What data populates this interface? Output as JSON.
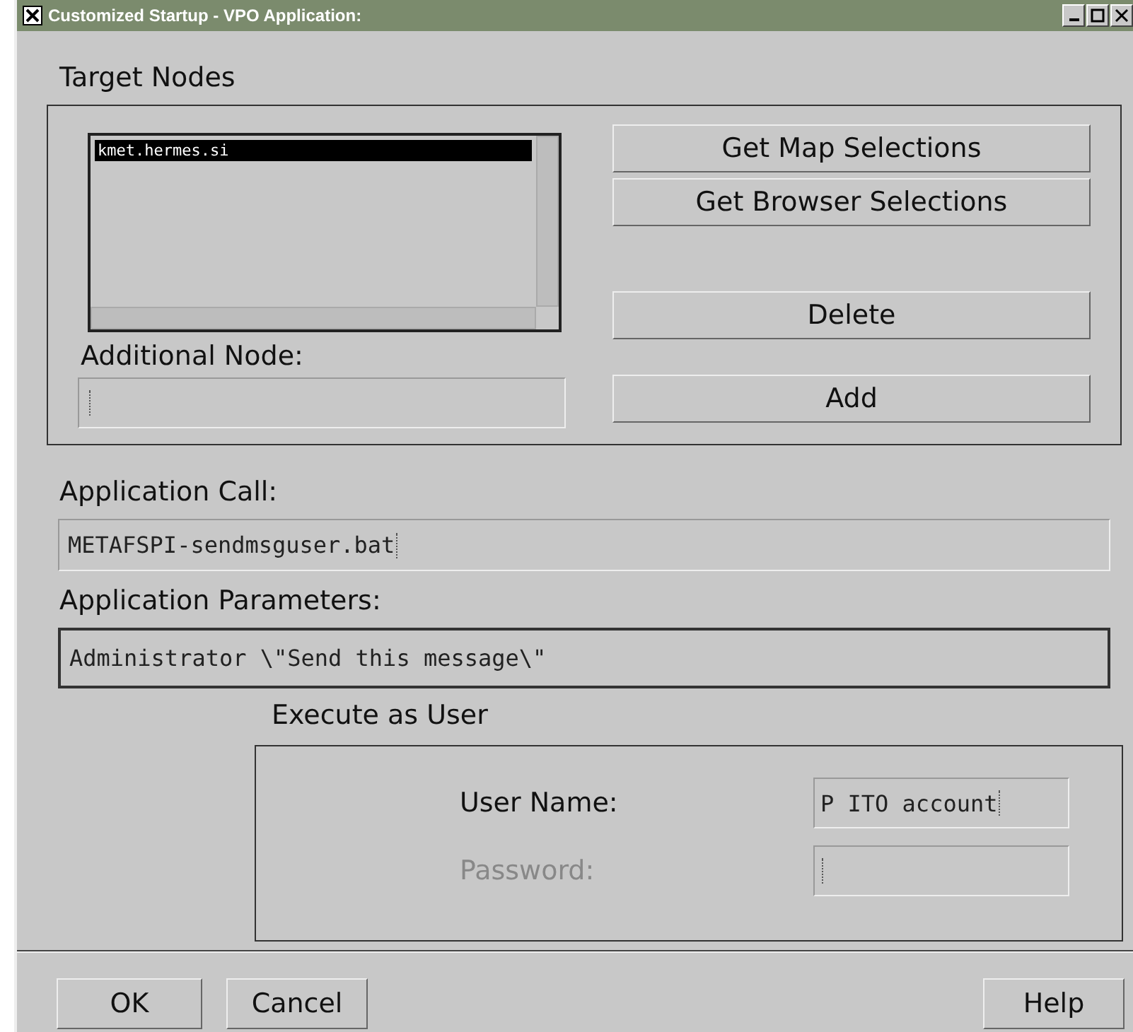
{
  "window": {
    "title": "Customized Startup - VPO Application:"
  },
  "target_nodes": {
    "label": "Target Nodes",
    "nodes": [
      {
        "name": "kmet.hermes.si",
        "selected": true
      }
    ],
    "additional_node": {
      "label": "Additional Node:"
    },
    "buttons": [
      "Get Map Selections",
      "Get Browser Selections",
      "Delete",
      "Add"
    ]
  },
  "application_call": {
    "label": "Application Call:",
    "value": "METAFSPI-sendmsguser.bat"
  },
  "application_parameters": {
    "label": "Application Parameters:",
    "value": "Administrator \\\"Send this message\\\""
  },
  "execute_as_user": {
    "label": "Execute as User",
    "fields": [
      {
        "label": "User Name:",
        "value": "P ITO account",
        "disabled": false
      },
      {
        "label": "Password:",
        "disabled": true
      }
    ]
  },
  "footer_buttons": [
    "OK",
    "Cancel",
    "Help"
  ]
}
